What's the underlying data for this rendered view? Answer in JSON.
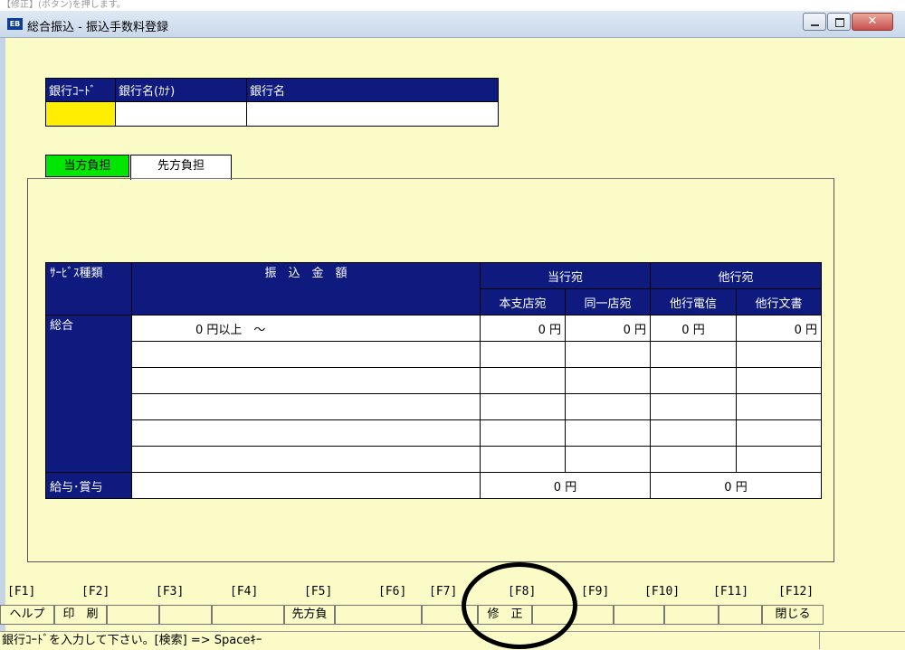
{
  "window": {
    "top_fragment": "【修正】(ボタン)を押します。",
    "app_icon": "EB",
    "title": "総合振込 - 振込手数料登録"
  },
  "bank": {
    "headers": [
      "銀行ｺｰﾄﾞ",
      "銀行名(ｶﾅ)",
      "銀行名"
    ],
    "code": "",
    "kana": "",
    "name": ""
  },
  "tabs": [
    {
      "label": "当方負担",
      "active": true
    },
    {
      "label": "先方負担",
      "active": false
    }
  ],
  "fee_table": {
    "service_type_header": "ｻｰﾋﾞｽ種類",
    "amount_header": "振　込　金　額",
    "same_bank_header": "当行宛",
    "other_bank_header": "他行宛",
    "sub_headers": [
      "本支店宛",
      "同一店宛",
      "他行電信",
      "他行文書"
    ],
    "row_general_label": "総合",
    "row_general_amount": "0 円以上　～",
    "row_general_fees": [
      "0 円",
      "0 円",
      "0 円",
      "0 円"
    ],
    "row_salary_label": "給与･賞与",
    "row_salary_fees": [
      "0 円",
      "0 円"
    ]
  },
  "function_keys": [
    {
      "key": "[F1]",
      "label": "ヘルプ"
    },
    {
      "key": "[F2]",
      "label": "印　刷"
    },
    {
      "key": "[F3]",
      "label": ""
    },
    {
      "key": "[F4]",
      "label": ""
    },
    {
      "key": "[F5]",
      "label": "先方負"
    },
    {
      "key": "[F6]",
      "label": ""
    },
    {
      "key": "[F7]",
      "label": ""
    },
    {
      "key": "[F8]",
      "label": "修　正"
    },
    {
      "key": "[F9]",
      "label": ""
    },
    {
      "key": "[F10]",
      "label": ""
    },
    {
      "key": "[F11]",
      "label": ""
    },
    {
      "key": "[F12]",
      "label": "閉じる"
    }
  ],
  "status": {
    "message": "銀行ｺｰﾄﾞを入力して下さい。[検索] => Spaceｷｰ"
  },
  "colors": {
    "header_bg": "#0e1a7e",
    "active_tab": "#00e600",
    "input_focus": "#ffee00",
    "window_bg": "#fbfbc8"
  }
}
